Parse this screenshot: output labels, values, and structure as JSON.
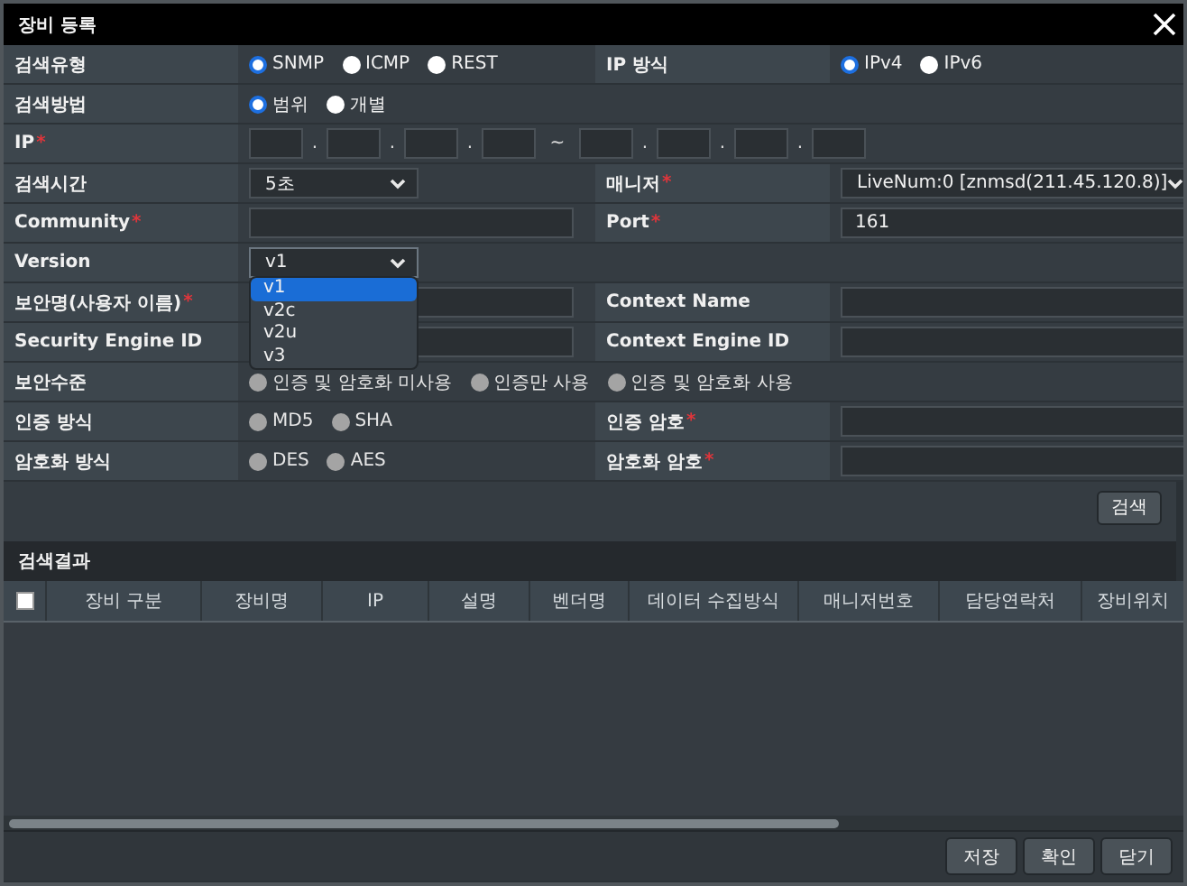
{
  "window": {
    "title": "장비 등록"
  },
  "form": {
    "rows": [
      {
        "cells": [
          {
            "label": "검색유형",
            "field": {
              "kind": "radio",
              "disabled": false,
              "options": [
                {
                  "label": "SNMP",
                  "selected": true
                },
                {
                  "label": "ICMP",
                  "selected": false
                },
                {
                  "label": "REST",
                  "selected": false
                }
              ]
            }
          },
          {
            "label": "IP 방식",
            "field": {
              "kind": "radio",
              "disabled": false,
              "options": [
                {
                  "label": "IPv4",
                  "selected": true
                },
                {
                  "label": "IPv6",
                  "selected": false
                }
              ]
            }
          }
        ]
      },
      {
        "cells": [
          {
            "label": "검색방법",
            "field": {
              "kind": "radio",
              "disabled": false,
              "options": [
                {
                  "label": "범위",
                  "selected": true
                },
                {
                  "label": "개별",
                  "selected": false
                }
              ]
            }
          }
        ]
      },
      {
        "cells": [
          {
            "label": "IP",
            "required_mark": "*",
            "field": {
              "kind": "ip_range",
              "separators": [
                ".",
                ".",
                ".",
                "~",
                ".",
                ".",
                "."
              ]
            }
          }
        ]
      },
      {
        "cells": [
          {
            "label": "검색시간",
            "field": {
              "kind": "select",
              "value": "5초"
            }
          },
          {
            "label": "매니저",
            "required_mark": "*",
            "field": {
              "kind": "select",
              "value": "LiveNum:0 [znmsd(211.45.120.8)]"
            }
          }
        ]
      },
      {
        "cells": [
          {
            "label": "Community",
            "required_mark": "*",
            "field": {
              "kind": "input"
            }
          },
          {
            "label": "Port",
            "required_mark": "*",
            "field": {
              "kind": "input",
              "value": "161"
            }
          }
        ]
      },
      {
        "cells": [
          {
            "label": "Version",
            "field": {
              "kind": "select",
              "value": "v1",
              "open": true,
              "options": [
                {
                  "label": "v1",
                  "selected": true
                },
                {
                  "label": "v2c",
                  "selected": false
                },
                {
                  "label": "v2u",
                  "selected": false
                },
                {
                  "label": "v3",
                  "selected": false
                }
              ]
            }
          }
        ]
      },
      {
        "cells": [
          {
            "label": "보안명(사용자 이름)",
            "required_mark": "*",
            "field": {
              "kind": "input"
            }
          },
          {
            "label": "Context Name",
            "field": {
              "kind": "input"
            }
          }
        ]
      },
      {
        "cells": [
          {
            "label": "Security Engine ID",
            "field": {
              "kind": "input"
            }
          },
          {
            "label": "Context Engine ID",
            "field": {
              "kind": "input"
            }
          }
        ]
      },
      {
        "cells": [
          {
            "label": "보안수준",
            "field": {
              "kind": "radio",
              "disabled": true,
              "options": [
                {
                  "label": "인증 및 암호화 미사용",
                  "selected": false
                },
                {
                  "label": "인증만 사용",
                  "selected": false
                },
                {
                  "label": "인증 및 암호화 사용",
                  "selected": false
                }
              ]
            }
          }
        ]
      },
      {
        "cells": [
          {
            "label": "인증 방식",
            "field": {
              "kind": "radio",
              "disabled": true,
              "options": [
                {
                  "label": "MD5",
                  "selected": false
                },
                {
                  "label": "SHA",
                  "selected": false
                }
              ]
            }
          },
          {
            "label": "인증 암호",
            "required_mark": "*",
            "field": {
              "kind": "input"
            }
          }
        ]
      },
      {
        "cells": [
          {
            "label": "암호화 방식",
            "field": {
              "kind": "radio",
              "disabled": true,
              "options": [
                {
                  "label": "DES",
                  "selected": false
                },
                {
                  "label": "AES",
                  "selected": false
                }
              ]
            }
          },
          {
            "label": "암호화 암호",
            "required_mark": "*",
            "field": {
              "kind": "input"
            }
          }
        ]
      }
    ],
    "search_button": "검색"
  },
  "results": {
    "title": "검색결과",
    "select_all": {
      "checked": false
    },
    "columns": [
      "장비 구분",
      "장비명",
      "IP",
      "설명",
      "벤더명",
      "데이터 수집방식",
      "매니저번호",
      "담당연락처",
      "장비위치"
    ]
  },
  "buttons": [
    "저장",
    "확인",
    "닫기"
  ]
}
